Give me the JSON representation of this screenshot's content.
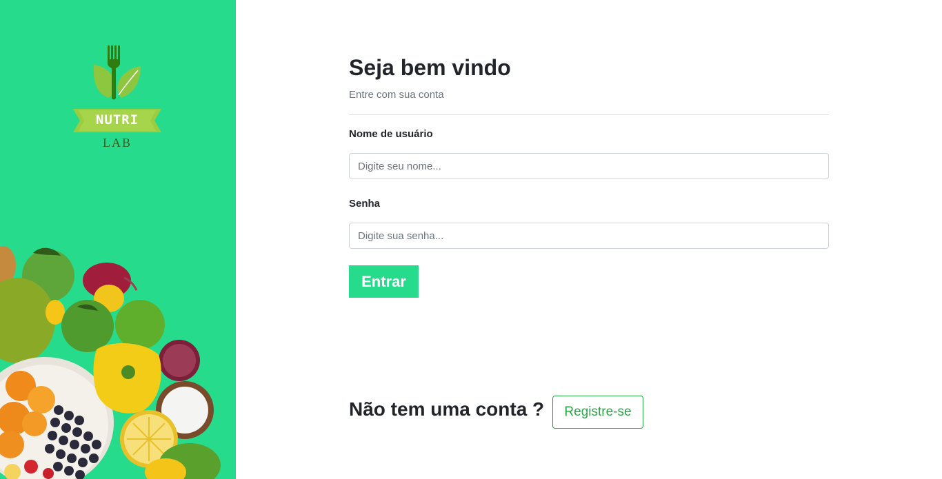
{
  "brand": {
    "logo_line1": "NUTRI",
    "logo_line2": "LAB",
    "color_primary": "#27db8c",
    "color_leaf": "#8dc63f",
    "color_fork": "#2f7d10"
  },
  "login": {
    "title": "Seja bem vindo",
    "subtitle": "Entre com sua conta",
    "username_label": "Nome de usuário",
    "username_placeholder": "Digite seu nome...",
    "username_value": "",
    "password_label": "Senha",
    "password_placeholder": "Digite sua senha...",
    "password_value": "",
    "submit_label": "Entrar"
  },
  "register": {
    "prompt": "Não tem uma conta ?",
    "button_label": "Registre-se",
    "button_color": "#28a745"
  },
  "icons": {
    "logo": "fork-leaf-icon",
    "decoration": "vegetables-illustration"
  }
}
